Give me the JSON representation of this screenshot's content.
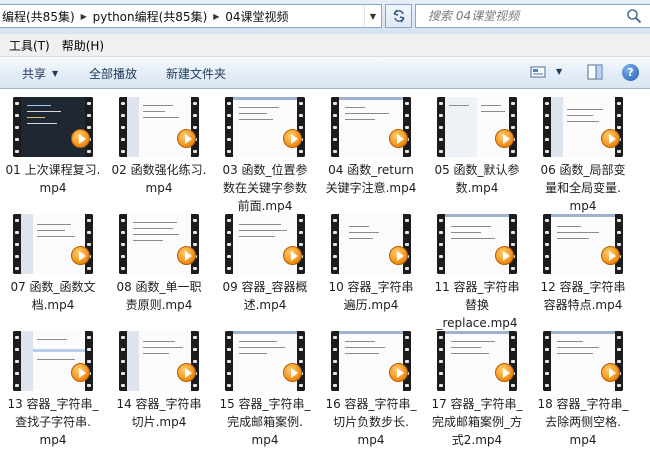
{
  "address_bar": {
    "crumbs": [
      "编程(共85集)",
      "python编程(共85集)",
      "04课堂视频"
    ]
  },
  "search": {
    "placeholder": "搜索 04课堂视频"
  },
  "menu": [
    "工具(T)",
    "帮助(H)"
  ],
  "toolbar": {
    "share": "共享",
    "play_all": "全部播放",
    "new_folder": "新建文件夹",
    "help": "?"
  },
  "icons": {
    "refresh": "refresh-icon",
    "search": "search-icon",
    "view": "view-options-icon",
    "preview_pane": "preview-pane-icon",
    "help": "help-icon",
    "video": "video-thumbnail-icon"
  },
  "colors": {
    "toolbar_text": "#1e395b",
    "play_badge": "#f08a10"
  },
  "files": [
    {
      "line1": "01 上次课程复习.",
      "line2": "mp4",
      "line3": ""
    },
    {
      "line1": "02 函数强化练习.",
      "line2": "mp4",
      "line3": ""
    },
    {
      "line1": "03 函数_位置参",
      "line2": "数在关键字参数",
      "line3": "前面.mp4"
    },
    {
      "line1": "04 函数_return",
      "line2": "关键字注意.mp4",
      "line3": ""
    },
    {
      "line1": "05 函数_默认参",
      "line2": "数.mp4",
      "line3": ""
    },
    {
      "line1": "06 函数_局部变",
      "line2": "量和全局变量.",
      "line3": "mp4"
    },
    {
      "line1": "07 函数_函数文",
      "line2": "档.mp4",
      "line3": ""
    },
    {
      "line1": "08 函数_单一职",
      "line2": "责原则.mp4",
      "line3": ""
    },
    {
      "line1": "09 容器_容器概",
      "line2": "述.mp4",
      "line3": ""
    },
    {
      "line1": "10 容器_字符串",
      "line2": "遍历.mp4",
      "line3": ""
    },
    {
      "line1": "11 容器_字符串",
      "line2": "替换",
      "line3": "_replace.mp4"
    },
    {
      "line1": "12 容器_字符串",
      "line2": "容器特点.mp4",
      "line3": ""
    },
    {
      "line1": "13 容器_字符串_",
      "line2": "查找子字符串.",
      "line3": "mp4"
    },
    {
      "line1": "14 容器_字符串",
      "line2": "切片.mp4",
      "line3": ""
    },
    {
      "line1": "15 容器_字符串_",
      "line2": "完成邮箱案例.",
      "line3": "mp4"
    },
    {
      "line1": "16 容器_字符串_",
      "line2": "切片负数步长.",
      "line3": "mp4"
    },
    {
      "line1": "17 容器_字符串_",
      "line2": "完成邮箱案例_方",
      "line3": "式2.mp4"
    },
    {
      "line1": "18 容器_字符串_",
      "line2": "去除两侧空格.",
      "line3": "mp4"
    }
  ]
}
